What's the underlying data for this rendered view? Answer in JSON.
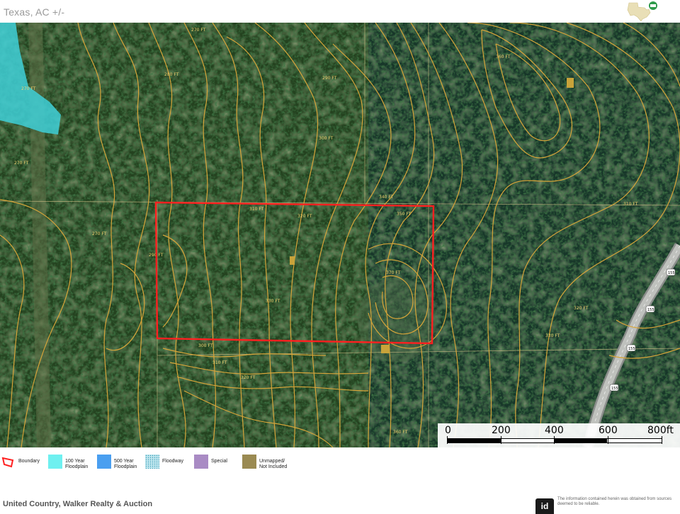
{
  "header": {
    "title": "Texas,  AC +/-",
    "logo": "texas-state-logo-icon"
  },
  "map": {
    "boundary_color": "#ff2020",
    "contour_color": "#d7a53a",
    "floodplain_color": "#3fd0d8",
    "contour_labels": [
      "270 FT",
      "280 FT",
      "290 FT",
      "300 FT",
      "310 FT",
      "320 FT",
      "330 FT",
      "340 FT",
      "350 FT",
      "360 FT",
      "370 FT"
    ],
    "road_labels": [
      "155",
      "155",
      "155",
      "155"
    ]
  },
  "scale": {
    "ticks": [
      "0",
      "200",
      "400",
      "600",
      "800ft"
    ]
  },
  "legend": {
    "items": [
      {
        "label": "Boundary",
        "color": "#ff2020",
        "type": "boundary"
      },
      {
        "label": "100 Year Floodplain",
        "color": "#6ff0f0",
        "type": "fill"
      },
      {
        "label": "500 Year Floodplain",
        "color": "#4a9ff0",
        "type": "fill"
      },
      {
        "label": "Floodway",
        "color": "#9fd8e8",
        "type": "dotted"
      },
      {
        "label": "Special",
        "color": "#a98bc4",
        "type": "fill"
      },
      {
        "label": "Unmapped/ Not Included",
        "color": "#9a8a52",
        "type": "fill"
      }
    ]
  },
  "footer": {
    "company": "United Country, Walker Realty & Auction",
    "badge": "id",
    "disclaimer": "The information contained herein was obtained from sources deemed to be reliable."
  }
}
